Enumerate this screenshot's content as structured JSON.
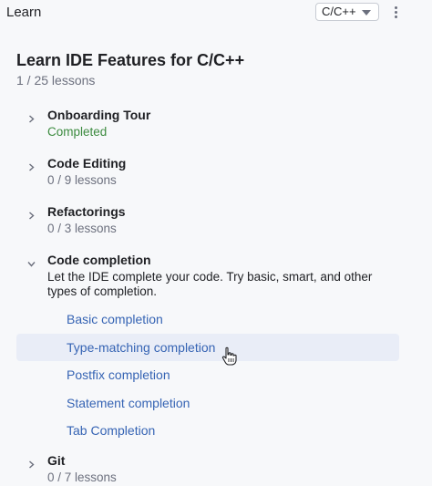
{
  "header": {
    "title": "Learn",
    "language": "C/C++"
  },
  "course": {
    "title": "Learn IDE Features for C/C++",
    "progress": "1 / 25 lessons"
  },
  "modules": [
    {
      "title": "Onboarding Tour",
      "status": "Completed",
      "expanded": false
    },
    {
      "title": "Code Editing",
      "status": "0 / 9 lessons",
      "expanded": false
    },
    {
      "title": "Refactorings",
      "status": "0 / 3 lessons",
      "expanded": false
    },
    {
      "title": "Code completion",
      "description": "Let the IDE complete your code. Try basic, smart, and other types of completion.",
      "expanded": true,
      "lessons": [
        {
          "label": "Basic completion"
        },
        {
          "label": "Type-matching completion"
        },
        {
          "label": "Postfix completion"
        },
        {
          "label": "Statement completion"
        },
        {
          "label": "Tab Completion"
        }
      ]
    },
    {
      "title": "Git",
      "status": "0 / 7 lessons",
      "expanded": false
    }
  ],
  "colors": {
    "completed": "#3c8b3f",
    "link": "#3664b4",
    "hover_row": "#e9edf7"
  }
}
